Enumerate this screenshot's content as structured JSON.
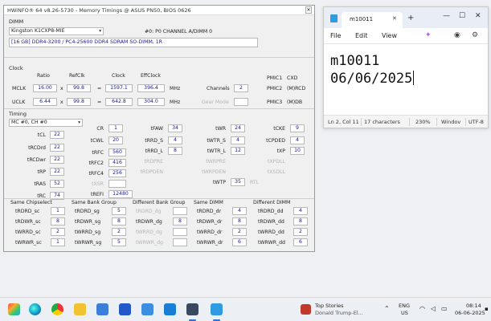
{
  "hwinfo": {
    "title": "HWiNFO® 64 v8.26-5730 - Memory Timings @ ASUS PN50, BIOS 0626",
    "close_glyph": "✕",
    "dimm": {
      "section_label": "DIMM",
      "module": "Kingston K1CXP8-MIE",
      "slot": "#0: P0 CHANNEL A/DIMM 0",
      "description": "[16 GB] DDR4-3200 / PC4-25600 DDR4 SDRAM SO-DIMM, 1R"
    },
    "clock": {
      "section_label": "Clock",
      "col_ratio": "Ratio",
      "col_refclk": "RefClk",
      "col_clock": "Clock",
      "col_effclock": "EffClock",
      "mclk_label": "MCLK",
      "mclk_ratio": "16.00",
      "mclk_refclk": "99.8",
      "mclk_clock": "1597.1",
      "mclk_eff": "396.4",
      "uclk_label": "UCLK",
      "uclk_ratio": "6.44",
      "uclk_refclk": "99.8",
      "uclk_clock": "642.8",
      "uclk_eff": "304.0",
      "op_x": "x",
      "op_eq": "=",
      "unit": "MHz",
      "channels_label": "Channels",
      "channels_value": "2",
      "gear_label": "Gear Mode",
      "pmic1_label": "PMIC1",
      "pmic1_value": "CXD",
      "pmic2_label": "PMIC2",
      "pmic2_value": "(M)RCD",
      "pmic3_label": "PMIC3",
      "pmic3_value": "(M)DB"
    },
    "timing": {
      "section_label": "Timing",
      "channel_select": "MC #0, CH #0",
      "cr_label": "CR",
      "cr_value": "1",
      "tfaw_label": "tFAW",
      "tfaw_value": "34",
      "twr_label": "tWR",
      "twr_value": "24",
      "tcke_label": "tCKE",
      "tcke_value": "9",
      "tcl_label": "tCL",
      "tcl_value": "22",
      "tcwl_label": "tCWL",
      "tcwl_value": "20",
      "trrds_label": "tRRD_S",
      "trrds_value": "4",
      "twtrs_label": "tWTR_S",
      "twtrs_value": "4",
      "tcpded_label": "tCPDED",
      "tcpded_value": "4",
      "trcdrd_label": "tRCDrd",
      "trcdrd_value": "22",
      "trfc_label": "tRFC",
      "trfc_value": "560",
      "trrdl_label": "tRRD_L",
      "trrdl_value": "8",
      "twtrl_label": "tWTR_L",
      "twtrl_value": "12",
      "txp_label": "tXP",
      "txp_value": "10",
      "trcdwr_label": "tRCDwr",
      "trcdwr_value": "22",
      "trfc2_label": "tRFC2",
      "trfc2_value": "416",
      "trdpre_label": "tRDPRE",
      "twrpre_label": "tWRPRE",
      "txpdll_label": "tXPDLL",
      "trp_label": "tRP",
      "trp_value": "22",
      "trfc4_label": "tRFC4",
      "trfc4_value": "256",
      "trdpden_label": "tRDPDEN",
      "twrpden_label": "tWRPDEN",
      "txsdll_label": "tXSDLL",
      "tras_label": "tRAS",
      "tras_value": "52",
      "txsr_label": "tXSR",
      "twtp_label": "tWTP",
      "twtp_value": "35",
      "rtl_label": "RTL",
      "trc_label": "tRC",
      "trc_value": "74",
      "trefi_label": "tREFI",
      "trefi_value": "12480"
    },
    "groups": {
      "same_cs": {
        "title": "Same Chipselect",
        "rows": [
          {
            "label": "tRDRD_sc",
            "value": "1"
          },
          {
            "label": "tRDWR_sc",
            "value": "8"
          },
          {
            "label": "tWRRD_sc",
            "value": "2"
          },
          {
            "label": "tWRWR_sc",
            "value": "1"
          }
        ]
      },
      "same_bg": {
        "title": "Same Bank Group",
        "rows": [
          {
            "label": "tRDRD_sg",
            "value": "5"
          },
          {
            "label": "tRDWR_sg",
            "value": "8"
          },
          {
            "label": "tWRRD_sg",
            "value": "2"
          },
          {
            "label": "tWRWR_sg",
            "value": "5"
          }
        ]
      },
      "diff_bg": {
        "title": "Different Bank Group",
        "rows": [
          {
            "label": "tRDRD_dg",
            "value": ""
          },
          {
            "label": "tRDWR_dg",
            "value": "8"
          },
          {
            "label": "tWRRD_dg",
            "value": ""
          },
          {
            "label": "tWRWR_dg",
            "value": ""
          }
        ]
      },
      "same_dimm": {
        "title": "Same DIMM",
        "rows": [
          {
            "label": "tRDRD_dr",
            "value": "4"
          },
          {
            "label": "tRDWR_dr",
            "value": "8"
          },
          {
            "label": "tWRRD_dr",
            "value": "2"
          },
          {
            "label": "tWRWR_dr",
            "value": "6"
          }
        ]
      },
      "diff_dimm": {
        "title": "Different DIMM",
        "rows": [
          {
            "label": "tRDRD_dd",
            "value": "4"
          },
          {
            "label": "tRDWR_dd",
            "value": "8"
          },
          {
            "label": "tWRRD_dd",
            "value": "2"
          },
          {
            "label": "tWRWR_dd",
            "value": "6"
          }
        ]
      }
    }
  },
  "notepad": {
    "tab_title": "m10011",
    "tab_close": "✕",
    "new_tab": "+",
    "minimize": "—",
    "maximize": "☐",
    "close": "✕",
    "menu_file": "File",
    "menu_edit": "Edit",
    "menu_view": "View",
    "line1": "m10011",
    "line2": "06/06/2025",
    "status_position": "Ln 2, Col 11",
    "status_chars": "17 characters",
    "status_zoom": "230%",
    "status_lineend": "Windov",
    "status_encoding": "UTF-8"
  },
  "taskbar": {
    "news_title": "Top Stories",
    "news_subtitle": "Donald Trump-El...",
    "chevron": "⌃",
    "lang1": "ENG",
    "lang2": "US",
    "time": "08:14",
    "date": "06-06-2025"
  }
}
